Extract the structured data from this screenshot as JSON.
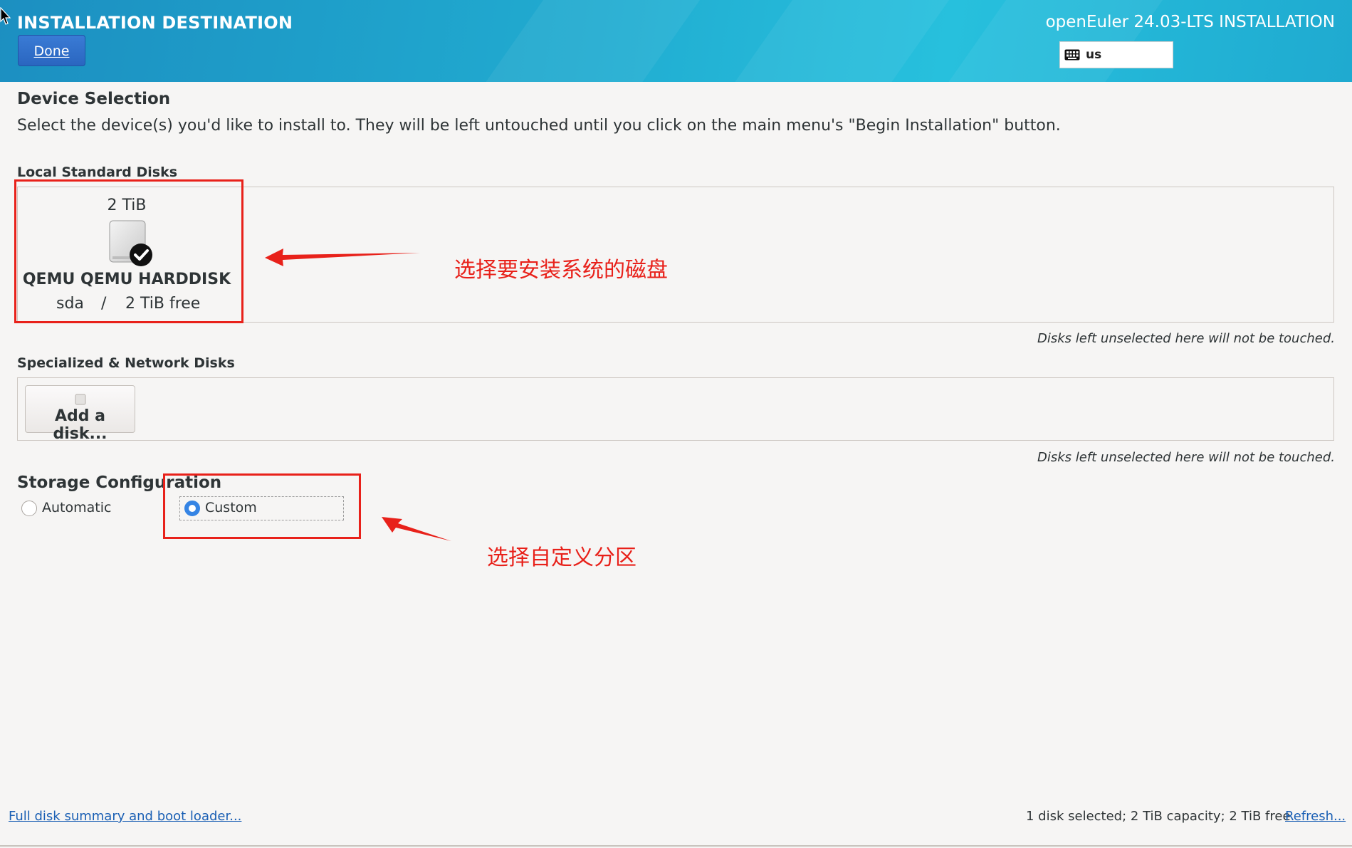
{
  "header": {
    "title": "INSTALLATION DESTINATION",
    "done_label": "Done",
    "product": "openEuler 24.03-LTS INSTALLATION",
    "keyboard_layout": "us"
  },
  "device_selection": {
    "title": "Device Selection",
    "description": "Select the device(s) you'd like to install to.  They will be left untouched until you click on the main menu's \"Begin Installation\" button."
  },
  "local_disks": {
    "title": "Local Standard Disks",
    "disk": {
      "size": "2 TiB",
      "name": "QEMU QEMU HARDDISK",
      "device": "sda",
      "separator": "/",
      "free": "2 TiB free"
    },
    "note": "Disks left unselected here will not be touched."
  },
  "network_disks": {
    "title": "Specialized & Network Disks",
    "add_label": "Add a disk...",
    "note": "Disks left unselected here will not be touched."
  },
  "storage": {
    "title": "Storage Configuration",
    "options": [
      {
        "label": "Automatic",
        "selected": false
      },
      {
        "label": "Custom",
        "selected": true
      }
    ]
  },
  "footer": {
    "summary_link": "Full disk summary and boot loader...",
    "status": "1 disk selected; 2 TiB capacity; 2 TiB free",
    "refresh_link": "Refresh..."
  },
  "annotations": {
    "disk_hint": "选择要安装系统的磁盘",
    "custom_hint": "选择自定义分区",
    "color": "#e8211a"
  },
  "colors": {
    "header_accent": "#20a9cf",
    "button_blue": "#3a7bd5",
    "link_blue": "#1a5fb4"
  }
}
